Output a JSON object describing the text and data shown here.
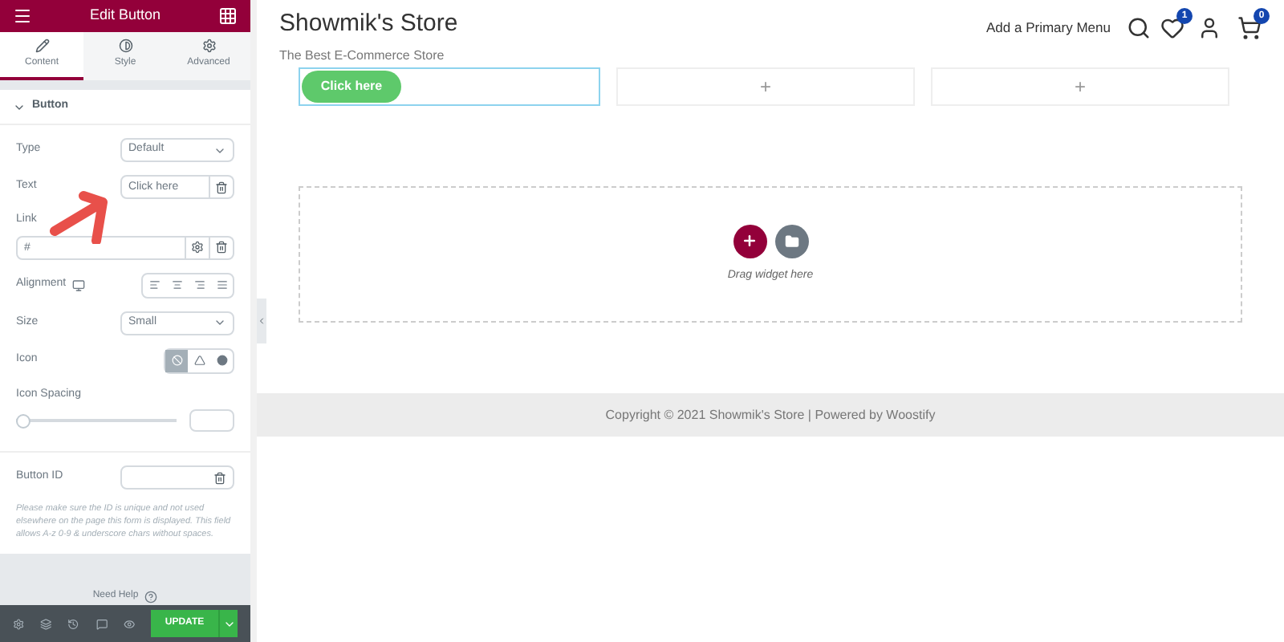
{
  "panel": {
    "title": "Edit Button",
    "tabs": [
      {
        "label": "Content",
        "selected": true
      },
      {
        "label": "Style",
        "selected": false
      },
      {
        "label": "Advanced",
        "selected": false
      }
    ],
    "section": "Button",
    "type": {
      "label": "Type",
      "value": "Default"
    },
    "text": {
      "label": "Text",
      "placeholder": "Click here"
    },
    "link": {
      "label": "Link",
      "placeholder": "#"
    },
    "alignment": {
      "label": "Alignment",
      "options": [
        {
          "selected": false
        },
        {
          "selected": false
        },
        {
          "selected": false
        },
        {
          "selected": false
        }
      ]
    },
    "size": {
      "label": "Size",
      "value": "Small"
    },
    "icon": {
      "label": "Icon",
      "options": [
        {
          "selected": true
        },
        {
          "selected": false
        },
        {
          "selected": false
        }
      ]
    },
    "icon_spacing": {
      "label": "Icon Spacing",
      "level": 0
    },
    "button_id": {
      "label": "Button ID",
      "note": "Please make sure the ID is unique and not used elsewhere on the page this form is displayed. This field allows A-z  0-9 & underscore chars without spaces."
    },
    "help": "Need Help",
    "update": "UPDATE"
  },
  "site": {
    "name": "Showmik's Store",
    "tagline": "The Best E-Commerce Store",
    "menu": "Add a Primary Menu",
    "wishlist_count": "1",
    "cart_count": "0",
    "button": "Click here",
    "add_marks": [
      "+",
      "+"
    ],
    "drop_hint": "Drag widget here",
    "footer": "Copyright © 2021 Showmik's Store | Powered by Woostify"
  }
}
